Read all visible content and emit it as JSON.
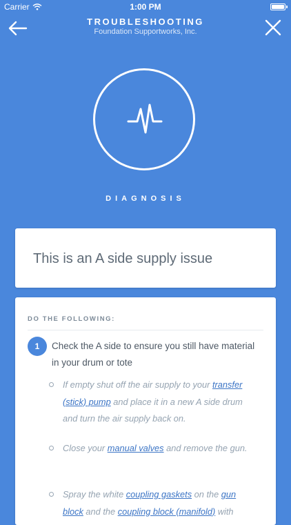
{
  "status_bar": {
    "carrier": "Carrier",
    "time": "1:00 PM"
  },
  "header": {
    "title": "TROUBLESHOOTING",
    "subtitle": "Foundation Supportworks, Inc."
  },
  "hero": {
    "icon": "pulse-icon",
    "label": "DIAGNOSIS"
  },
  "issue": {
    "text": "This is an A side supply issue"
  },
  "steps": {
    "header": "DO THE FOLLOWING:",
    "items": [
      {
        "number": "1",
        "text": "Check the A side to ensure you still have material in your drum or tote",
        "subitems": [
          {
            "t1": "If empty shut off the air supply to your ",
            "link1": "transfer (stick) pump",
            "t2": " and place it in a new A side drum and turn the air supply back on."
          },
          {
            "t1": "Close your ",
            "link1": "manual valves",
            "t2": " and remove the gun."
          },
          {
            "t1": "Spray the white ",
            "link1": "coupling gaskets",
            "t2": " on the ",
            "link2": "gun block",
            "t3": " and the ",
            "link3": "coupling block (manifold)",
            "t4": " with"
          }
        ]
      }
    ]
  },
  "colors": {
    "background": "#4a87dc",
    "card": "#ffffff",
    "link": "#3b74c5",
    "badge": "#4a87dc"
  }
}
